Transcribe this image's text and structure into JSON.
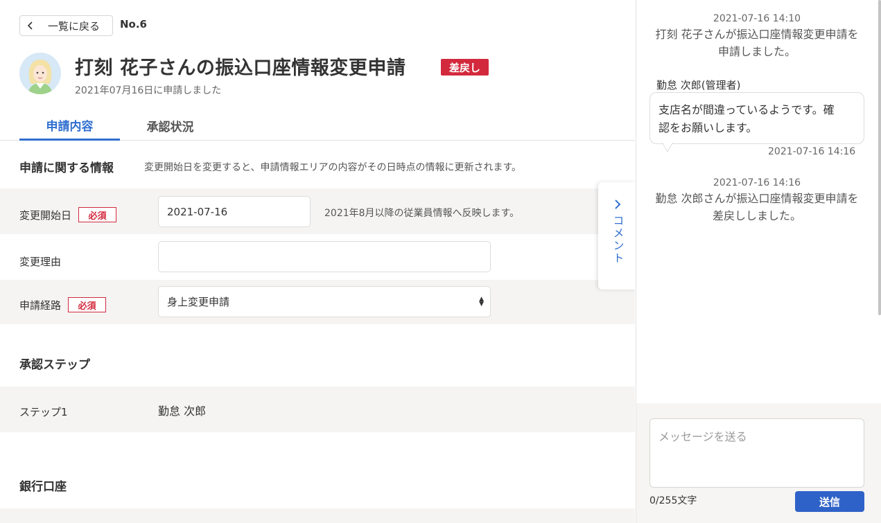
{
  "header": {
    "back_label": "一覧に戻る",
    "doc_no": "No.6",
    "title": "打刻 花子さんの振込口座情報変更申請",
    "status": "差戻し",
    "subtitle": "2021年07月16日に申請しました"
  },
  "tabs": [
    {
      "label": "申請内容",
      "active": true
    },
    {
      "label": "承認状況",
      "active": false
    }
  ],
  "info_section": {
    "title": "申請に関する情報",
    "note": "変更開始日を変更すると、申請情報エリアの内容がその日時点の情報に更新されます。"
  },
  "form": {
    "start_date": {
      "label": "変更開始日",
      "required": "必須",
      "value": "2021-07-16",
      "hint": "2021年8月以降の従業員情報へ反映します。"
    },
    "reason": {
      "label": "変更理由",
      "value": ""
    },
    "route": {
      "label": "申請経路",
      "required": "必須",
      "value": "身上変更申請"
    }
  },
  "approval_section": {
    "title": "承認ステップ",
    "steps": [
      {
        "label": "ステップ1",
        "approver": "勤怠 次郎"
      }
    ]
  },
  "bank_section": {
    "title": "銀行口座"
  },
  "comment_tab": {
    "label": "コメント"
  },
  "panel": {
    "log1": {
      "time": "2021-07-16 14:10",
      "line1": "打刻 花子さんが振込口座情報変更申請を",
      "line2": "申請しました。"
    },
    "comment": {
      "author": "勤怠 次郎(管理者)",
      "line1": "支店名が間違っているようです。確",
      "line2": "認をお願いします。",
      "time": "2021-07-16 14:16"
    },
    "log2": {
      "time": "2021-07-16 14:16",
      "line1": "勤怠 次郎さんが振込口座情報変更申請を",
      "line2": "差戻ししました。"
    },
    "composer": {
      "placeholder": "メッセージを送る",
      "counter": "0/255文字",
      "send_label": "送信"
    }
  },
  "colors": {
    "accent": "#2f6fd0",
    "danger": "#d3293d",
    "send": "#2f62c8"
  }
}
